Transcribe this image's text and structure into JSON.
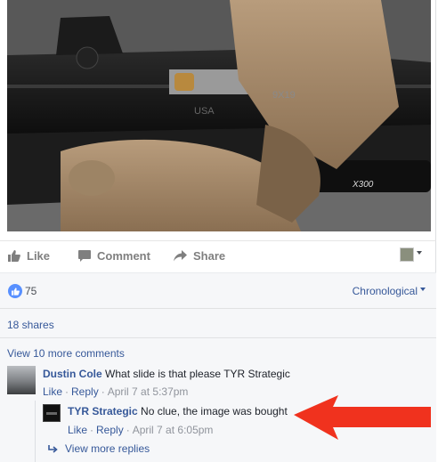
{
  "actions": {
    "like_label": "Like",
    "comment_label": "Comment",
    "share_label": "Share"
  },
  "reactions": {
    "count": "75",
    "order_label": "Chronological"
  },
  "shares": {
    "label": "18 shares"
  },
  "comments": {
    "view_more_label": "View 10 more comments",
    "items": [
      {
        "author": "Dustin Cole",
        "text": "What slide is that please TYR Strategic",
        "like_label": "Like",
        "reply_label": "Reply",
        "time": "April 7 at 5:37pm"
      },
      {
        "author": "TYR Strategic",
        "text": "No clue, the image was bought",
        "like_label": "Like",
        "reply_label": "Reply",
        "time": "April 7 at 6:05pm"
      }
    ],
    "view_more_replies_label": "View more replies"
  },
  "photo": {
    "markings": [
      "9X19",
      "USA",
      "X300"
    ]
  },
  "colors": {
    "link": "#365899",
    "muted": "#90949c",
    "action_gray": "#7f7f7f",
    "like_blue": "#5890ff",
    "arrow_red": "#f0321e"
  },
  "icons": [
    "thumbs-up-icon",
    "speech-bubble-icon",
    "share-arrow-icon",
    "caret-down-icon",
    "reply-arrow-icon",
    "annotation-arrow"
  ]
}
